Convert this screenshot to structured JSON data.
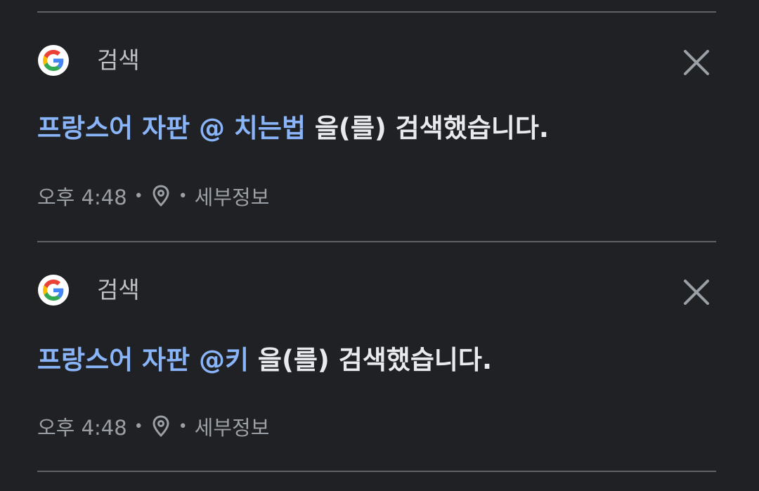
{
  "items": [
    {
      "source_label": "검색",
      "query": "프랑스어 자판 @ 치는법",
      "suffix": " 을(를) 검색했습니다.",
      "time": "오후 4:48",
      "dot": "•",
      "details_label": "세부정보"
    },
    {
      "source_label": "검색",
      "query": "프랑스어 자판 @키",
      "suffix": " 을(를) 검색했습니다.",
      "time": "오후 4:48",
      "dot": "•",
      "details_label": "세부정보"
    }
  ],
  "icons": {
    "logo": "google-g-icon",
    "close": "close-icon",
    "location": "location-pin-icon"
  },
  "colors": {
    "background": "#202124",
    "link": "#8ab4f8",
    "text": "#e8eaed",
    "secondary": "#9aa0a6",
    "divider": "#5f6368"
  }
}
